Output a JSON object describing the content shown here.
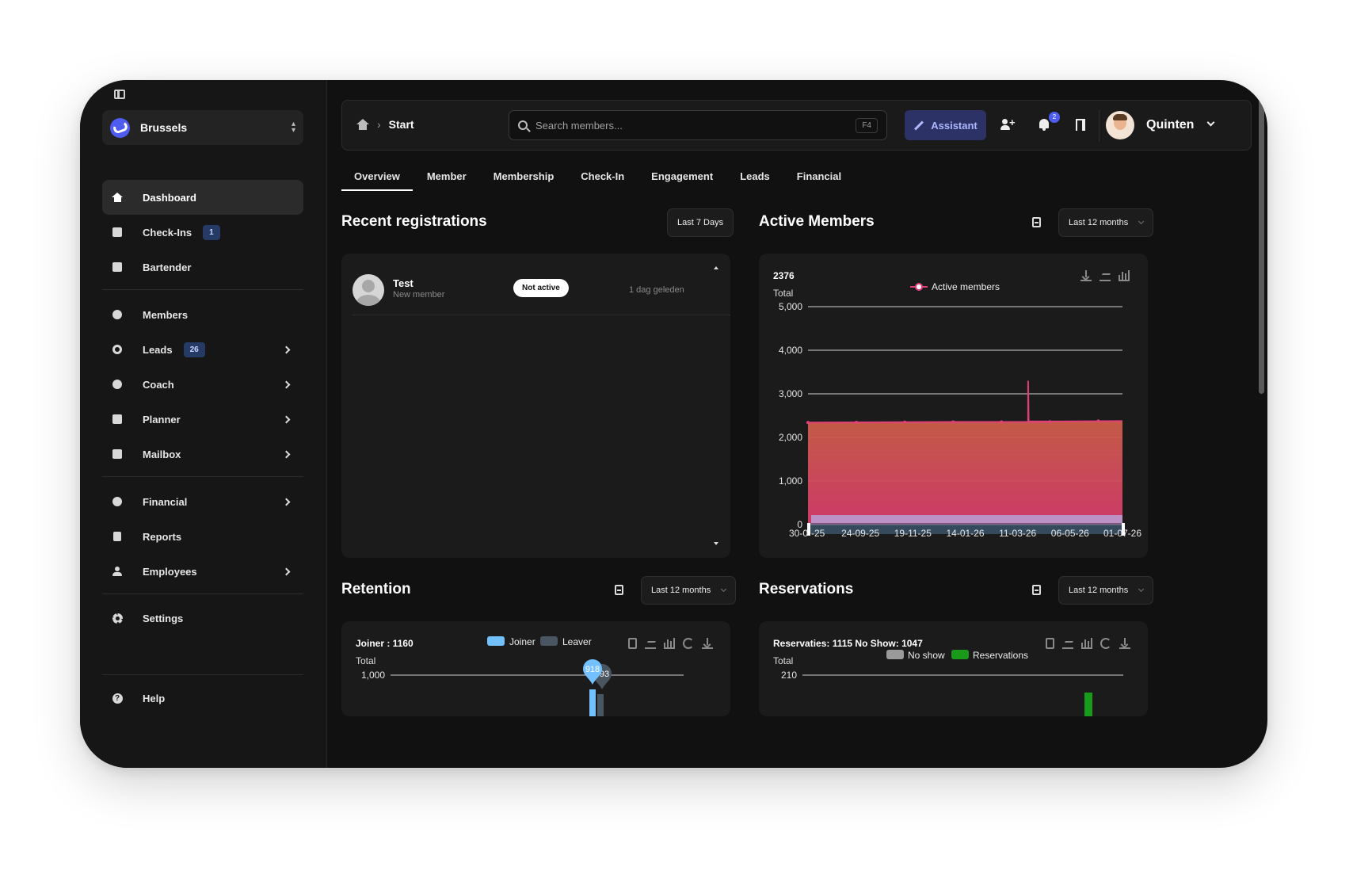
{
  "sidebar": {
    "location": "Brussels",
    "items": [
      {
        "label": "Dashboard"
      },
      {
        "label": "Check-Ins",
        "badge": "1"
      },
      {
        "label": "Bartender"
      },
      {
        "label": "Members"
      },
      {
        "label": "Leads",
        "badge": "26"
      },
      {
        "label": "Coach"
      },
      {
        "label": "Planner"
      },
      {
        "label": "Mailbox"
      },
      {
        "label": "Financial"
      },
      {
        "label": "Reports"
      },
      {
        "label": "Employees"
      },
      {
        "label": "Settings"
      },
      {
        "label": "Help"
      }
    ]
  },
  "header": {
    "breadcrumb": "Start",
    "search_placeholder": "Search members...",
    "search_shortcut": "F4",
    "assistant_label": "Assistant",
    "notifications_count": "2",
    "user_name": "Quinten"
  },
  "tabs": [
    "Overview",
    "Member",
    "Membership",
    "Check-In",
    "Engagement",
    "Leads",
    "Financial"
  ],
  "recent_registrations": {
    "title": "Recent registrations",
    "filter": "Last 7 Days",
    "rows": [
      {
        "name": "Test",
        "type": "New member",
        "status": "Not active",
        "time": "1 dag geleden"
      }
    ]
  },
  "active_members": {
    "title": "Active Members",
    "filter": "Last 12 months",
    "total_value": "2376",
    "total_label": "Total"
  },
  "retention": {
    "title": "Retention",
    "filter": "Last 12 months",
    "summary": "Joiner : 1160",
    "total_label": "Total"
  },
  "reservations": {
    "title": "Reservations",
    "filter": "Last 12 months",
    "summary": "Reservaties: 1115  No Show: 1047",
    "total_label": "Total"
  },
  "chart_data": [
    {
      "id": "active_members",
      "type": "area",
      "legend": [
        "Active members"
      ],
      "ylim": [
        0,
        5000
      ],
      "yticks": [
        "0",
        "1,000",
        "2,000",
        "3,000",
        "4,000",
        "5,000"
      ],
      "xtick_labels": [
        "30-07-25",
        "24-09-25",
        "19-11-25",
        "14-01-26",
        "11-03-26",
        "06-05-26",
        "01-07-26"
      ],
      "series": [
        {
          "name": "Active members",
          "color": "#e0407a",
          "points": [
            [
              0,
              2340
            ],
            [
              1,
              2345
            ],
            [
              2,
              2350
            ],
            [
              3,
              2355
            ],
            [
              4,
              2355
            ],
            [
              5,
              2360
            ],
            [
              4.55,
              2360
            ],
            [
              4.55,
              3300
            ],
            [
              4.56,
              2365
            ],
            [
              5.2,
              2365
            ],
            [
              6.5,
              2376
            ]
          ]
        }
      ]
    },
    {
      "id": "retention",
      "type": "bar",
      "legend": [
        "Joiner",
        "Leaver"
      ],
      "colors": {
        "Joiner": "#73c0ff",
        "Leaver": "#4a5562"
      },
      "yticks": [
        "1,000"
      ],
      "markers": [
        {
          "series": "Joiner",
          "value": 918
        },
        {
          "series": "Leaver",
          "value": 893
        }
      ]
    },
    {
      "id": "reservations",
      "type": "bar",
      "legend": [
        "No show",
        "Reservations"
      ],
      "colors": {
        "No show": "#9a9a9a",
        "Reservations": "#1a9a1a"
      },
      "yticks": [
        "210"
      ]
    }
  ]
}
